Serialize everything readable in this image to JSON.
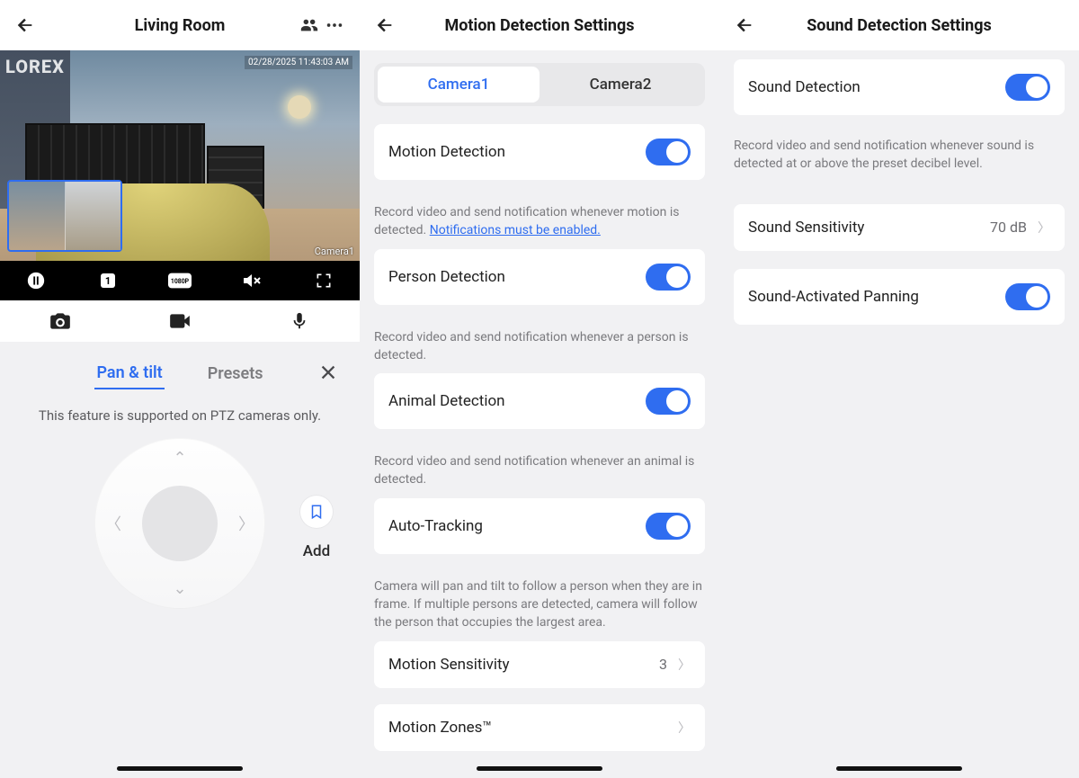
{
  "pane1": {
    "title": "Living Room",
    "brand": "LOREX",
    "timestamp": "02/28/2025 11:43:03 AM",
    "camera_overlay": "Camera1",
    "resolution_badge": "1080P",
    "grid_badge": "1",
    "tab_pan_tilt": "Pan & tilt",
    "tab_presets": "Presets",
    "note": "This feature is supported on PTZ cameras only.",
    "add_label": "Add"
  },
  "pane2": {
    "title": "Motion Detection Settings",
    "seg_camera1": "Camera1",
    "seg_camera2": "Camera2",
    "motion_detection": {
      "label": "Motion Detection",
      "desc": "Record video and send notification whenever motion is detected. ",
      "link": "Notifications must be enabled."
    },
    "person_detection": {
      "label": "Person Detection",
      "desc": "Record video and send notification whenever a person is detected."
    },
    "animal_detection": {
      "label": "Animal Detection",
      "desc": "Record video and send notification whenever an animal is detected."
    },
    "auto_tracking": {
      "label": "Auto-Tracking",
      "desc": "Camera will pan and tilt to follow a person when they are in frame. If multiple persons are detected, camera will follow the person that occupies the largest area."
    },
    "motion_sensitivity": {
      "label": "Motion Sensitivity",
      "value": "3"
    },
    "motion_zones": {
      "label": "Motion Zones™"
    }
  },
  "pane3": {
    "title": "Sound Detection Settings",
    "sound_detection": {
      "label": "Sound Detection",
      "desc": "Record video and send notification whenever sound is detected at or above the preset decibel level."
    },
    "sound_sensitivity": {
      "label": "Sound Sensitivity",
      "value": "70 dB"
    },
    "sound_panning": {
      "label": "Sound-Activated Panning"
    }
  }
}
